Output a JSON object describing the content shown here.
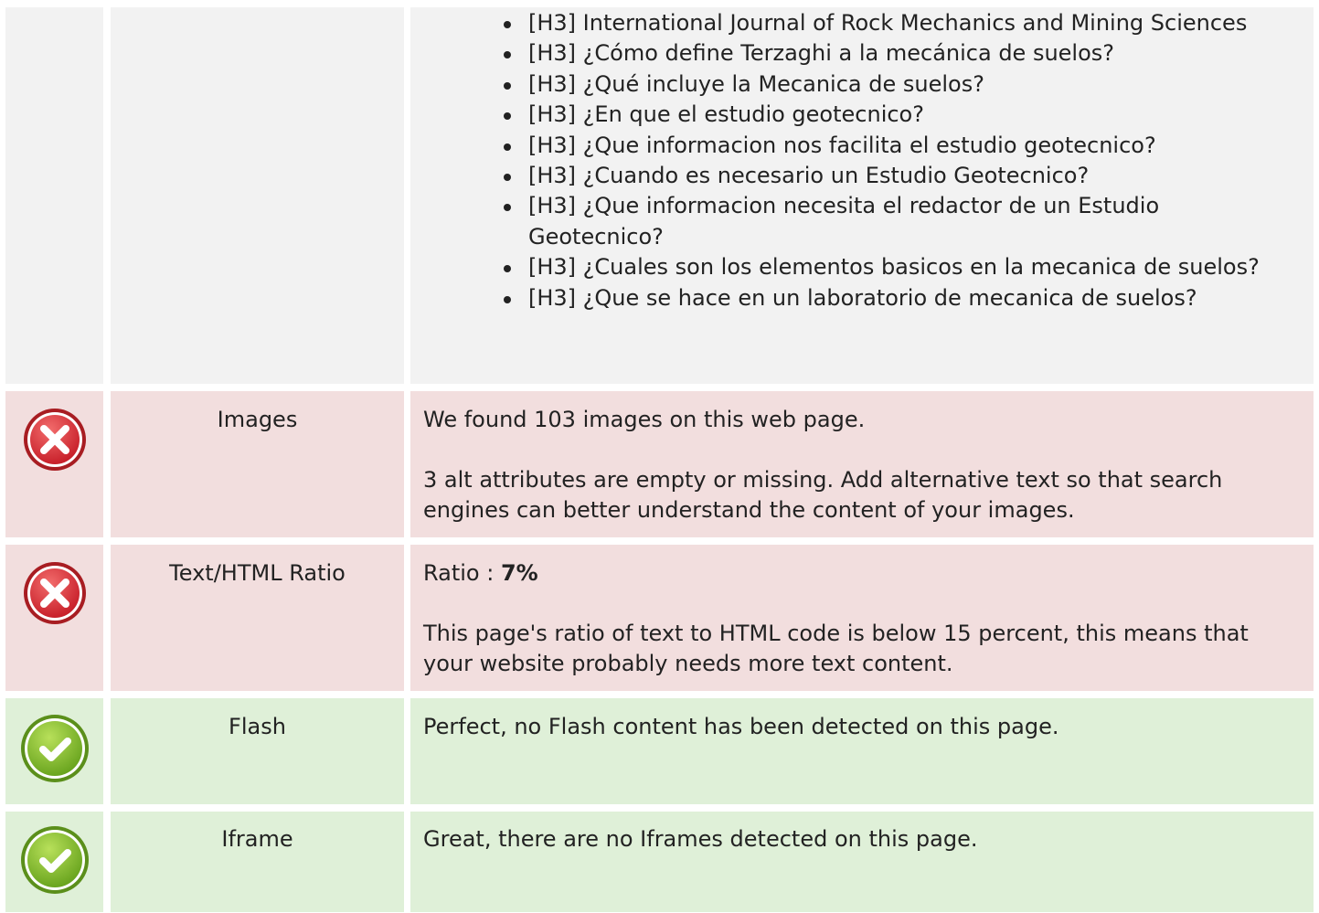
{
  "headings_row": {
    "items": [
      "[H3] International Journal of Rock Mechanics and Mining Sciences",
      "[H3] ¿Cómo define Terzaghi a la mecánica de suelos?",
      "[H3] ¿Qué incluye la Mecanica de suelos?",
      "[H3] ¿En que el estudio geotecnico?",
      "[H3] ¿Que informacion nos facilita el estudio geotecnico?",
      "[H3] ¿Cuando es necesario un Estudio Geotecnico?",
      "[H3] ¿Que informacion necesita el redactor de un Estudio Geotecnico?",
      "[H3] ¿Cuales son los elementos basicos en la mecanica de suelos?",
      "[H3] ¿Que se hace en un laboratorio de mecanica de suelos?"
    ]
  },
  "images_row": {
    "status": "error",
    "label": "Images",
    "line1": "We found 103 images on this web page.",
    "line2": "3 alt attributes are empty or missing. Add alternative text so that search engines can better understand the content of your images."
  },
  "ratio_row": {
    "status": "error",
    "label": "Text/HTML Ratio",
    "ratio_prefix": "Ratio : ",
    "ratio_value": "7%",
    "line2": "This page's ratio of text to HTML code is below 15 percent, this means that your website probably needs more text content."
  },
  "flash_row": {
    "status": "ok",
    "label": "Flash",
    "line1": "Perfect, no Flash content has been detected on this page."
  },
  "iframe_row": {
    "status": "ok",
    "label": "Iframe",
    "line1": "Great, there are no Iframes detected on this page."
  },
  "colors": {
    "error_bg": "#f2dede",
    "ok_bg": "#dff0d8",
    "neutral_bg": "#f2f2f2",
    "error_icon": "#d9383a",
    "ok_icon": "#8cc63f"
  }
}
